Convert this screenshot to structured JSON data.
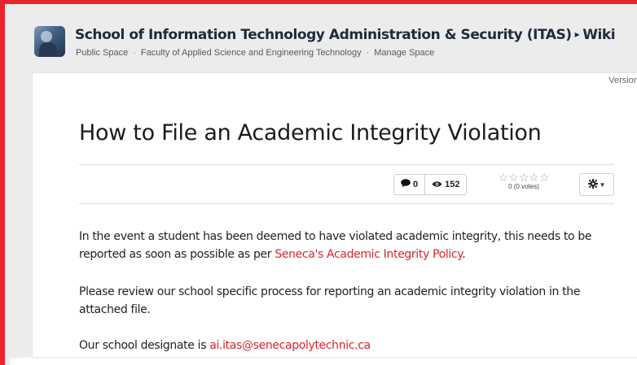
{
  "header": {
    "space_name": "School of Information Technology Administration & Security (ITAS)",
    "separator": "▸",
    "section": "Wiki",
    "crumbs": [
      "Public Space",
      "Faculty of Applied Science and Engineering Technology",
      "Manage Space"
    ],
    "crumb_separator": "·"
  },
  "page": {
    "version_label": "Version",
    "title": "How to File an Academic Integrity Violation",
    "comments_count": "0",
    "views_count": "152",
    "rating_stars": "☆☆☆☆☆",
    "rating_votes": "0 (0 votes)",
    "icons": [
      "comment-icon",
      "eye-icon",
      "star-icon",
      "gear-icon"
    ]
  },
  "body": {
    "p1_text": "In the event a student has been deemed to have violated academic integrity, this needs to be reported as soon as possible as per ",
    "p1_link": "Seneca's Academic Integrity Policy",
    "p1_end": ".",
    "p2_text": "Please review our school specific process for reporting an academic integrity violation in the attached file.",
    "p3_text": "Our school designate is ",
    "p3_link": "ai.itas@senecapolytechnic.ca"
  },
  "colors": {
    "accent_border": "#e8242b",
    "link": "#d9252b",
    "background": "#ececec"
  }
}
